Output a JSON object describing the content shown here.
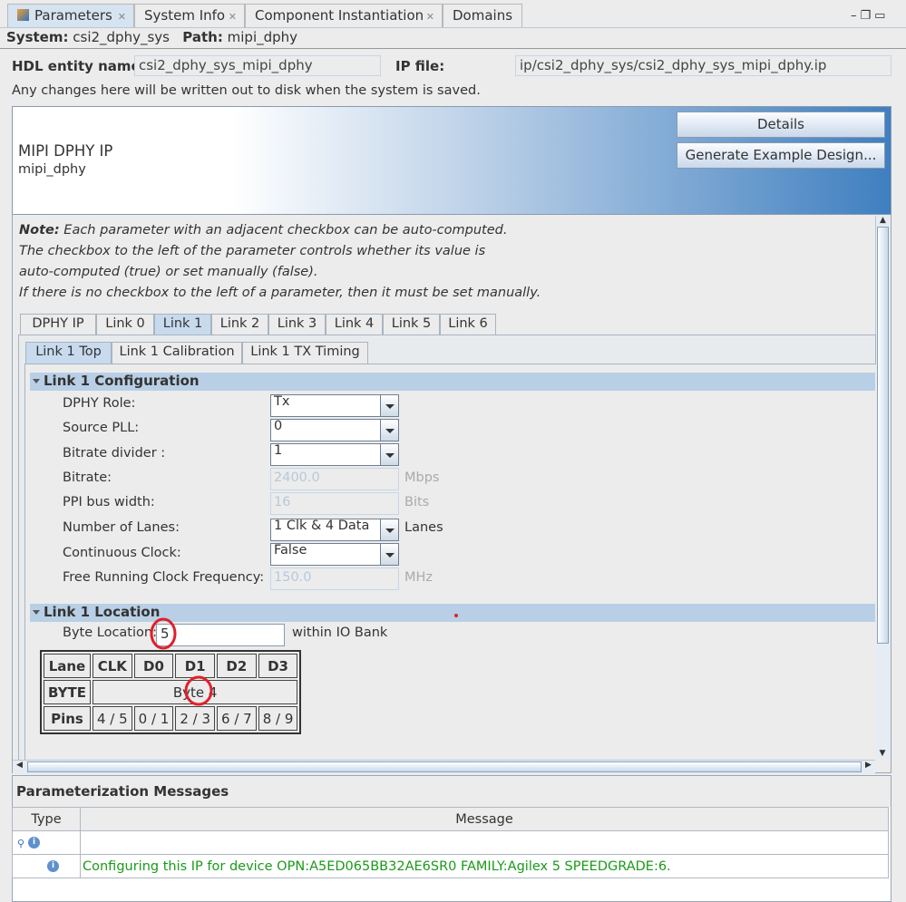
{
  "tabs": [
    {
      "label": "Parameters",
      "icon": "parameters-icon"
    },
    {
      "label": "System Info"
    },
    {
      "label": "Component Instantiation"
    },
    {
      "label": "Domains"
    }
  ],
  "system": {
    "system_label": "System:",
    "system_value": "csi2_dphy_sys",
    "path_label": "Path:",
    "path_value": "mipi_dphy"
  },
  "hdl": {
    "label": "HDL entity name:",
    "value": "csi2_dphy_sys_mipi_dphy",
    "ip_label": "IP file:",
    "ip_value": "ip/csi2_dphy_sys/csi2_dphy_sys_mipi_dphy.ip"
  },
  "notice": "Any changes here will be written out to disk when the system is saved.",
  "header": {
    "title": "MIPI DPHY IP",
    "subtitle": "mipi_dphy",
    "details": "Details",
    "generate": "Generate Example Design..."
  },
  "note": {
    "bold": "Note:",
    "line1": " Each parameter with an adjacent checkbox can be auto-computed.",
    "line2": "The checkbox to the left of the parameter controls whether its value is",
    "line3": "auto-computed (true) or set manually (false).",
    "line4": "If there is no checkbox to the left of a parameter, then it must be set manually."
  },
  "link_tabs": [
    "DPHY IP",
    "Link 0",
    "Link 1",
    "Link 2",
    "Link 3",
    "Link 4",
    "Link 5",
    "Link 6"
  ],
  "sub_tabs": [
    "Link 1 Top",
    "Link 1 Calibration",
    "Link 1 TX Timing"
  ],
  "config": {
    "title": "Link 1 Configuration",
    "rows": [
      {
        "label": "DPHY Role:",
        "value": "Tx",
        "unit": ""
      },
      {
        "label": "Source PLL:",
        "value": "0",
        "unit": ""
      },
      {
        "label": "Bitrate divider :",
        "value": "1",
        "unit": ""
      },
      {
        "label": "Bitrate:",
        "value": "2400.0",
        "unit": "Mbps"
      },
      {
        "label": "PPI bus width:",
        "value": "16",
        "unit": "Bits"
      },
      {
        "label": "Number of Lanes:",
        "value": "1 Clk & 4 Data",
        "unit": "Lanes"
      },
      {
        "label": "Continuous Clock:",
        "value": "False",
        "unit": ""
      },
      {
        "label": "Free Running Clock Frequency:",
        "value": "150.0",
        "unit": "MHz"
      }
    ]
  },
  "location": {
    "title": "Link 1 Location",
    "byte_label": "Byte Location:",
    "byte_value": "5",
    "byte_suffix": "within IO Bank",
    "table": {
      "lane": [
        "Lane",
        "CLK",
        "D0",
        "D1",
        "D2",
        "D3"
      ],
      "byte_label": "BYTE",
      "byte_value": "Byte 4",
      "pins": [
        "Pins",
        "4 / 5",
        "0 / 1",
        "2 / 3",
        "6 / 7",
        "8 / 9"
      ]
    }
  },
  "messages": {
    "title": "Parameterization Messages",
    "col_type": "Type",
    "col_message": "Message",
    "rows": [
      {
        "message": ""
      },
      {
        "message": "Configuring this IP for device OPN:A5ED065BB32AE6SR0 FAMILY:Agilex 5 SPEEDGRADE:6."
      }
    ]
  },
  "colors": {
    "accent": "#3f7fc0",
    "message_green": "#1a9a1a",
    "annotation": "#e0202a"
  }
}
